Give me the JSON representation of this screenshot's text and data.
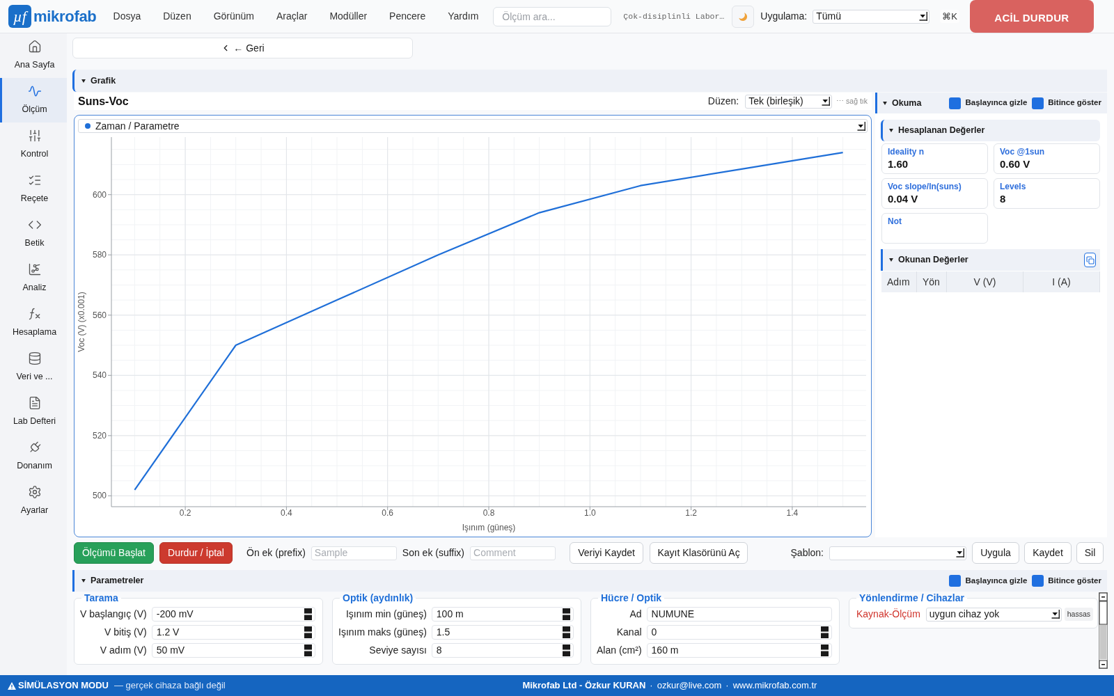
{
  "top_bar": {
    "logo": {
      "mark": "µf",
      "name": "mikrofab"
    },
    "menu": [
      "Dosya",
      "Düzen",
      "Görünüm",
      "Araçlar",
      "Modüller",
      "Pencere",
      "Yardım"
    ],
    "search": {
      "placeholder": "Ölçüm ara..."
    },
    "lab_name": "Çok-disiplinli Labor…",
    "app_filter": {
      "label": "Uygulama:",
      "value": "Tümü"
    },
    "shortcut": "⌘K",
    "emergency_stop": "ACİL DURDUR"
  },
  "sidebar": {
    "items": [
      {
        "label": "Ana Sayfa",
        "selected": false
      },
      {
        "label": "Ölçüm",
        "selected": true
      },
      {
        "label": "Kontrol",
        "selected": false
      },
      {
        "label": "Reçete",
        "selected": false
      },
      {
        "label": "Betik",
        "selected": false
      },
      {
        "label": "Analiz",
        "selected": false
      },
      {
        "label": "Hesaplama",
        "selected": false
      },
      {
        "label": "Veri ve ...",
        "selected": false
      },
      {
        "label": "Lab Defteri",
        "selected": false
      },
      {
        "label": "Donanım",
        "selected": false
      },
      {
        "label": "Ayarlar",
        "selected": false
      }
    ]
  },
  "back_button": "← Geri",
  "graph_section": {
    "title": "Grafik",
    "expanded": true,
    "layout": {
      "label": "Düzen:",
      "value": "Tek (birleşik)"
    },
    "hint": "⋯ sağ tık",
    "plot_selector": "Zaman / Parametre",
    "chart_data": {
      "type": "line",
      "title": "Suns-Voc",
      "xlabel": "Işınım (güneş)",
      "ylabel": "Voc (V) (x0.001)",
      "x": [
        0.1,
        0.3,
        0.5,
        0.7,
        0.9,
        1.1,
        1.3,
        1.5
      ],
      "series": [
        {
          "color": "#1f6fd8",
          "values": [
            502,
            550,
            565,
            580,
            594,
            603,
            608.5,
            614
          ]
        }
      ],
      "xlim": [
        0.054,
        1.546
      ],
      "ylim": [
        496.4,
        619.1
      ],
      "xticks": [
        0.2,
        0.4,
        0.6,
        0.8,
        {
          "value": 1,
          "label": "1.0"
        },
        1.2,
        1.4
      ],
      "yticks": [
        500,
        520,
        540,
        560,
        580,
        600
      ],
      "grid": true
    }
  },
  "reading_panel": {
    "title": "Okuma",
    "expanded": true,
    "options": [
      {
        "label": "Başlayınca gizle",
        "checked": true
      },
      {
        "label": "Bitince göster",
        "checked": true
      }
    ],
    "computed": {
      "title": "Hesaplanan Değerler",
      "expanded": true,
      "cards": [
        {
          "label": "Ideality n",
          "value": "1.60"
        },
        {
          "label": "Voc @1sun",
          "value": "0.60 V"
        },
        {
          "label": "Voc slope/ln(suns)",
          "value": "0.04 V"
        },
        {
          "label": "Levels",
          "value": "8"
        },
        {
          "label": "Not"
        }
      ]
    },
    "readings": {
      "title": "Okunan Değerler",
      "expanded": true,
      "columns": [
        "Adım",
        "Yön",
        "V (V)",
        "I (A)"
      ]
    }
  },
  "actions": {
    "start": "Ölçümü Başlat",
    "stop": "Durdur / İptal",
    "prefix": {
      "label": "Ön ek (prefix)",
      "placeholder": "Sample"
    },
    "suffix": {
      "label": "Son ek (suffix)",
      "placeholder": "Comment"
    },
    "save_data": "Veriyi Kaydet",
    "open_folder": "Kayıt Klasörünü Aç",
    "template": {
      "label": "Şablon:"
    },
    "template_buttons": [
      "Uygula",
      "Kaydet",
      "Sil"
    ]
  },
  "parameters": {
    "title": "Parametreler",
    "expanded": true,
    "options": [
      {
        "label": "Başlayınca gizle",
        "checked": true
      },
      {
        "label": "Bitince göster",
        "checked": true
      }
    ],
    "groups": [
      {
        "title": "Tarama",
        "fields": [
          {
            "kind": "number",
            "label": "V başlangıç (V)",
            "value": "-200 mV"
          },
          {
            "kind": "number",
            "label": "V bitiş (V)",
            "value": "1.2 V"
          },
          {
            "kind": "number",
            "label": "V adım (V)",
            "value": "50 mV"
          }
        ]
      },
      {
        "title": "Optik (aydınlık)",
        "fields": [
          {
            "kind": "number",
            "label": "Işınım min (güneş)",
            "value": "100 m"
          },
          {
            "kind": "number",
            "label": "Işınım maks (güneş)",
            "value": "1.5"
          },
          {
            "kind": "number",
            "label": "Seviye sayısı",
            "value": "8"
          }
        ]
      },
      {
        "title": "Hücre / Optik",
        "fields": [
          {
            "kind": "text",
            "label": "Ad",
            "value": "NUMUNE"
          },
          {
            "kind": "number",
            "label": "Kanal",
            "value": "0"
          },
          {
            "kind": "number",
            "label": "Alan (cm²)",
            "value": "160 m"
          }
        ]
      },
      {
        "title": "Yönlendirme / Cihazlar",
        "fields": [
          {
            "kind": "select",
            "label": "Kaynak-Ölçüm",
            "value": "uygun cihaz yok",
            "unavailable": true,
            "toggle": "hassas"
          }
        ]
      }
    ]
  },
  "status_bar": {
    "mode": "SİMÜLASYON MODU",
    "note": "— gerçek cihaza bağlı değil",
    "credits": [
      {
        "kind": "strong",
        "text": "Mikrofab Ltd - Özkur KURAN"
      },
      {
        "kind": "sep",
        "text": "·"
      },
      {
        "kind": "link",
        "text": "ozkur@live.com"
      },
      {
        "kind": "sep",
        "text": "·"
      },
      {
        "kind": "link",
        "text": "www.mikrofab.com.tr"
      }
    ]
  }
}
